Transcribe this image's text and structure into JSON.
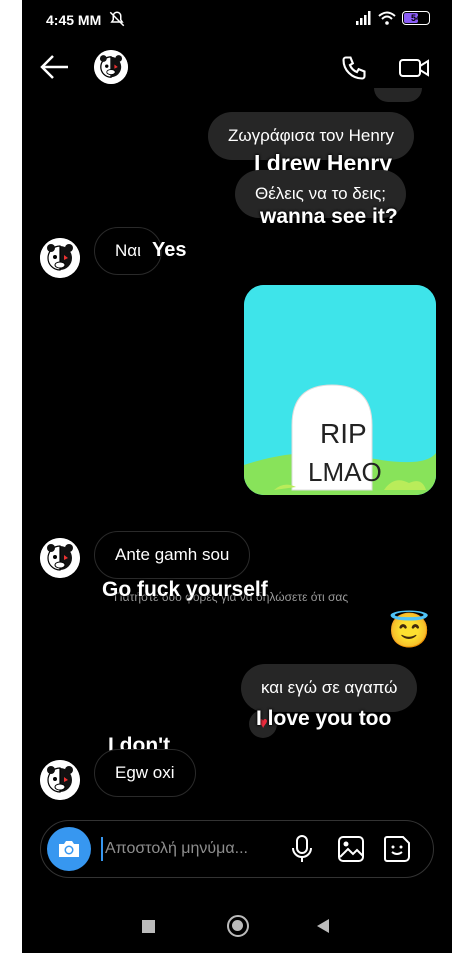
{
  "status_bar": {
    "time": "4:45 MM",
    "battery": "54"
  },
  "messages": {
    "m1_text": "Ζωγράφισα τον Henry",
    "m1_caption": "I drew Henry",
    "m2_text": "Θέλεις να το δεις;",
    "m2_caption": "wanna see it?",
    "m3_text": "Ναι",
    "m3_caption": "Yes",
    "image_text_line1": "RIP",
    "image_text_line2": "LMAO",
    "m4_text": "Ante gamh sou",
    "m4_caption": "Go fuck yourself",
    "hint_text": "Πατήστε δύο φορές για να δηλώσετε ότι σας",
    "m5_emoji": "😇",
    "m6_text": "και εγώ σε αγαπώ",
    "m6_caption": "I love you too",
    "m6_reaction": "♥",
    "m7_text": "Egw oxi",
    "m7_caption": "I don't"
  },
  "composer": {
    "placeholder": "Αποστολή μηνύμα..."
  },
  "colors": {
    "background": "#000000",
    "sent_bubble": "#262626",
    "accent_blue": "#3797f0",
    "image_bg": "#3ee4ea",
    "grass": "#88e35a"
  }
}
